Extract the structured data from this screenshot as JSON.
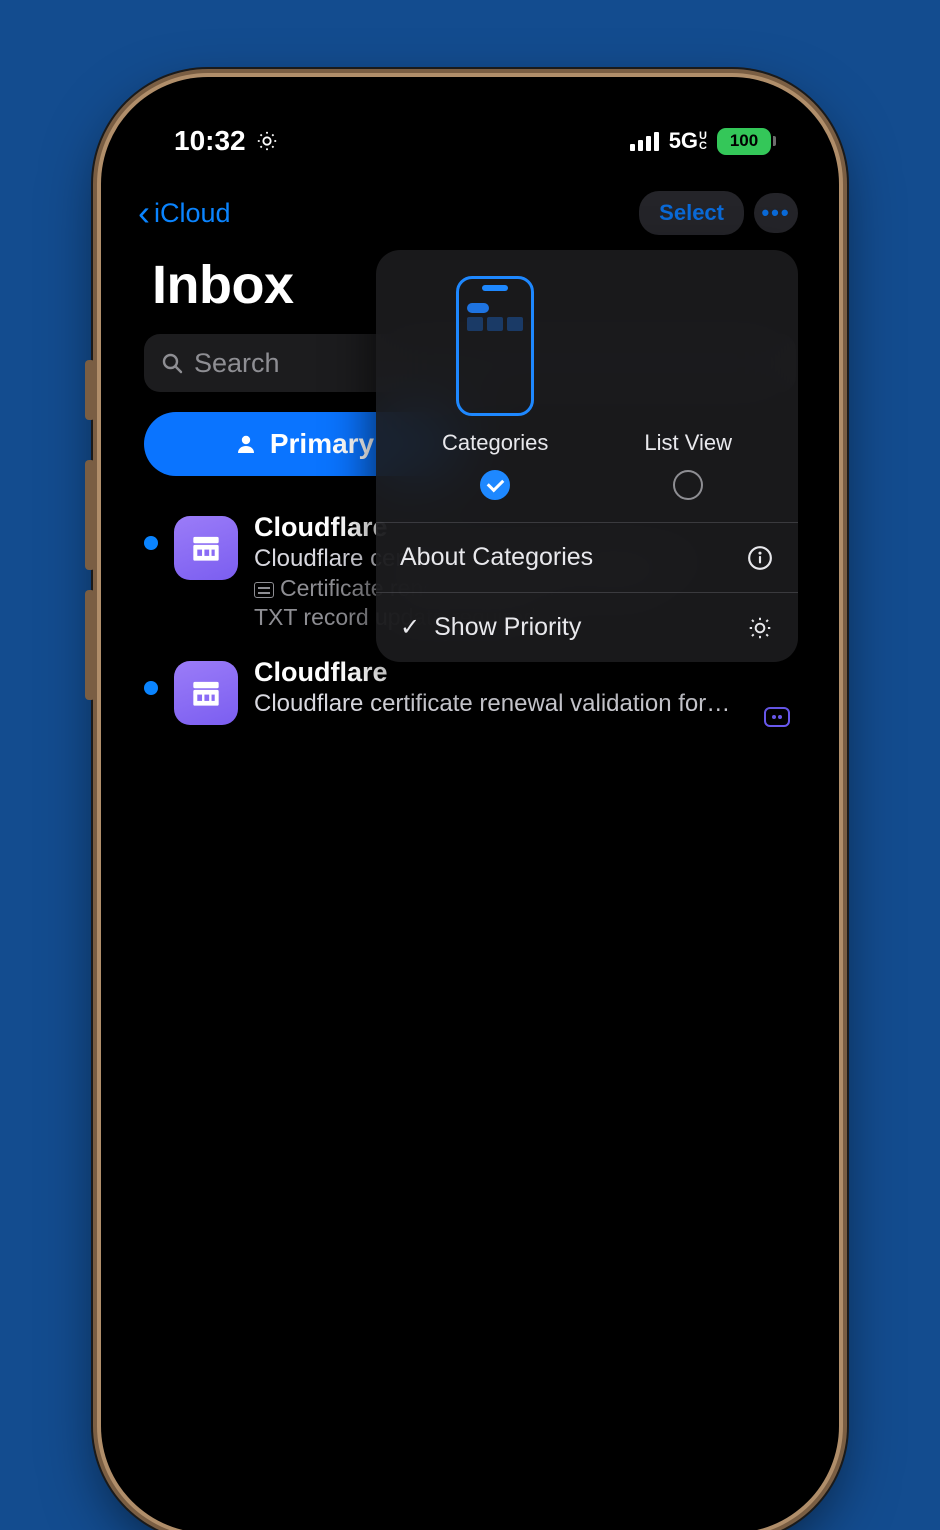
{
  "statusbar": {
    "time": "10:32",
    "network": "5G",
    "network_sub": "U\nC",
    "battery": "100"
  },
  "nav": {
    "back_label": "iCloud",
    "select_label": "Select"
  },
  "page": {
    "title": "Inbox",
    "search_placeholder": "Search"
  },
  "tabs": {
    "primary": "Primary"
  },
  "emails": [
    {
      "sender": "Cloudflare",
      "subject": "Cloudflare certificate renewal validation for…",
      "summary": "Certificate renewal validation pending",
      "preview2": "TXT record update required"
    },
    {
      "sender": "Cloudflare",
      "subject": "Cloudflare certificate renewal validation for…"
    }
  ],
  "popover": {
    "option_categories": "Categories",
    "option_listview": "List View",
    "about_label": "About Categories",
    "show_priority_label": "Show Priority"
  },
  "colors": {
    "accent": "#0a84ff",
    "background": "#134c8f",
    "battery_green": "#34c759",
    "avatar": "#8a6cf6"
  }
}
